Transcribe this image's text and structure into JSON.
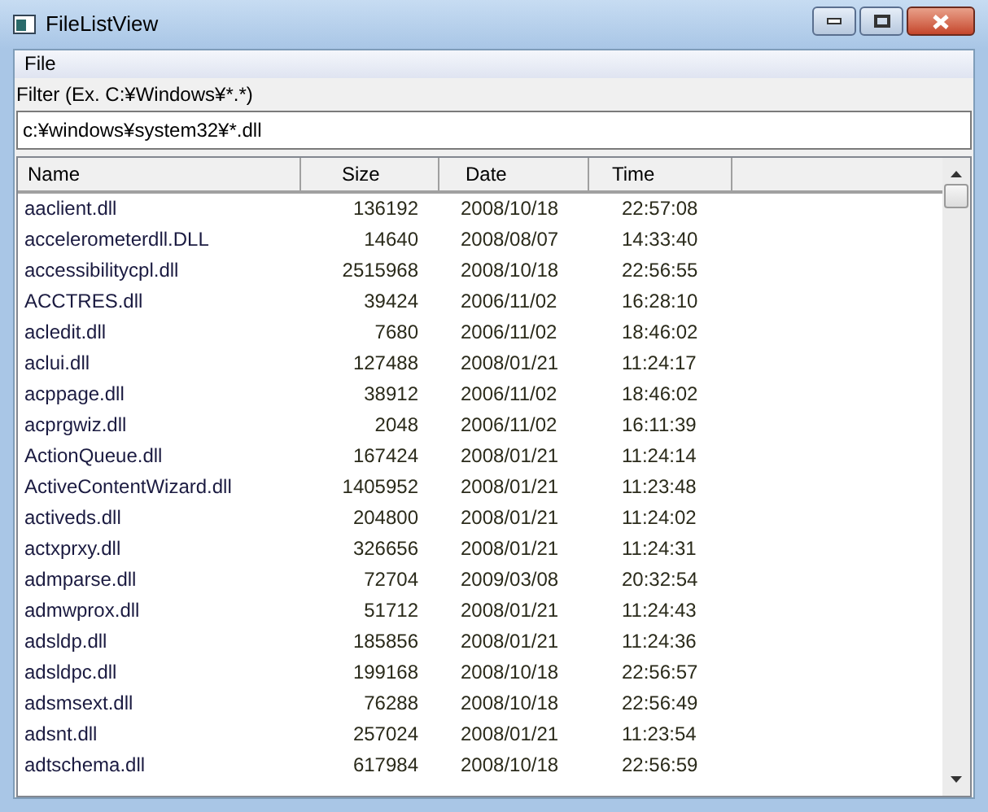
{
  "window": {
    "title": "FileListView"
  },
  "menu": [
    "File"
  ],
  "filter": {
    "label": "Filter (Ex. C:¥Windows¥*.*)",
    "value": "c:¥windows¥system32¥*.dll"
  },
  "table": {
    "columns": [
      "Name",
      "Size",
      "Date",
      "Time"
    ],
    "rows": [
      [
        "aaclient.dll",
        "136192",
        "2008/10/18",
        "22:57:08"
      ],
      [
        "accelerometerdll.DLL",
        "14640",
        "2008/08/07",
        "14:33:40"
      ],
      [
        "accessibilitycpl.dll",
        "2515968",
        "2008/10/18",
        "22:56:55"
      ],
      [
        "ACCTRES.dll",
        "39424",
        "2006/11/02",
        "16:28:10"
      ],
      [
        "acledit.dll",
        "7680",
        "2006/11/02",
        "18:46:02"
      ],
      [
        "aclui.dll",
        "127488",
        "2008/01/21",
        "11:24:17"
      ],
      [
        "acppage.dll",
        "38912",
        "2006/11/02",
        "18:46:02"
      ],
      [
        "acprgwiz.dll",
        "2048",
        "2006/11/02",
        "16:11:39"
      ],
      [
        "ActionQueue.dll",
        "167424",
        "2008/01/21",
        "11:24:14"
      ],
      [
        "ActiveContentWizard.dll",
        "1405952",
        "2008/01/21",
        "11:23:48"
      ],
      [
        "activeds.dll",
        "204800",
        "2008/01/21",
        "11:24:02"
      ],
      [
        "actxprxy.dll",
        "326656",
        "2008/01/21",
        "11:24:31"
      ],
      [
        "admparse.dll",
        "72704",
        "2009/03/08",
        "20:32:54"
      ],
      [
        "admwprox.dll",
        "51712",
        "2008/01/21",
        "11:24:43"
      ],
      [
        "adsldp.dll",
        "185856",
        "2008/01/21",
        "11:24:36"
      ],
      [
        "adsldpc.dll",
        "199168",
        "2008/10/18",
        "22:56:57"
      ],
      [
        "adsmsext.dll",
        "76288",
        "2008/10/18",
        "22:56:49"
      ],
      [
        "adsnt.dll",
        "257024",
        "2008/01/21",
        "11:23:54"
      ],
      [
        "adtschema.dll",
        "617984",
        "2008/10/18",
        "22:56:59"
      ]
    ]
  }
}
